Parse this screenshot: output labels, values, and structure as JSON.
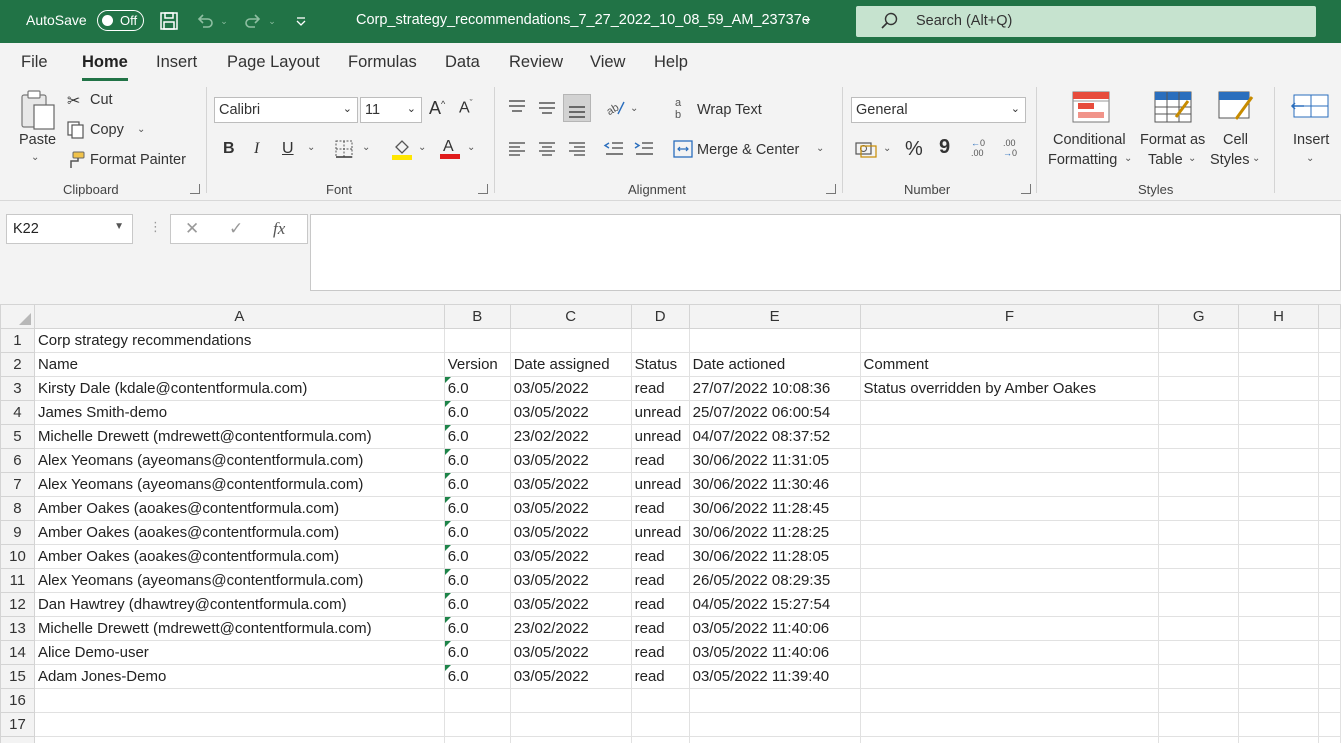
{
  "titlebar": {
    "autosave_label": "AutoSave",
    "autosave_state": "Off",
    "file_title": "Corp_strategy_recommendations_7_27_2022_10_08_59_AM_23737e",
    "search_placeholder": "Search (Alt+Q)",
    "icons": [
      "save-icon",
      "undo-icon",
      "redo-icon",
      "customize-qat-icon",
      "search-icon"
    ]
  },
  "tabs": [
    "File",
    "Home",
    "Insert",
    "Page Layout",
    "Formulas",
    "Data",
    "Review",
    "View",
    "Help"
  ],
  "ribbon": {
    "clipboard": {
      "paste": "Paste",
      "cut": "Cut",
      "copy": "Copy",
      "format_painter": "Format Painter",
      "group": "Clipboard"
    },
    "font": {
      "name": "Calibri",
      "size": "11",
      "bold": "B",
      "italic": "I",
      "underline": "U",
      "group": "Font"
    },
    "alignment": {
      "wrap_text": "Wrap Text",
      "merge_center": "Merge & Center",
      "group": "Alignment"
    },
    "number": {
      "format": "General",
      "percent": "%",
      "comma": "9",
      "group": "Number"
    },
    "styles": {
      "conditional_1": "Conditional",
      "conditional_2": "Formatting",
      "format_table_1": "Format as",
      "format_table_2": "Table",
      "cell_styles_1": "Cell",
      "cell_styles_2": "Styles",
      "group": "Styles"
    },
    "cells": {
      "insert": "Insert"
    }
  },
  "formula_bar": {
    "name_box": "K22",
    "cancel": "✕",
    "enter": "✓",
    "fx": "fx",
    "content": ""
  },
  "grid": {
    "columns": [
      "A",
      "B",
      "C",
      "D",
      "E",
      "F",
      "G",
      "H"
    ],
    "rows": [
      {
        "n": "1",
        "cells": [
          "Corp strategy recommendations",
          "",
          "",
          "",
          "",
          ""
        ]
      },
      {
        "n": "2",
        "cells": [
          "Name",
          "Version",
          "Date assigned",
          "Status",
          "Date actioned",
          "Comment"
        ]
      },
      {
        "n": "3",
        "cells": [
          "Kirsty Dale (kdale@contentformula.com)",
          "6.0",
          "03/05/2022",
          "read",
          "27/07/2022 10:08:36",
          "Status overridden by Amber Oakes"
        ]
      },
      {
        "n": "4",
        "cells": [
          "James Smith-demo",
          "6.0",
          "03/05/2022",
          "unread",
          "25/07/2022 06:00:54",
          ""
        ]
      },
      {
        "n": "5",
        "cells": [
          "Michelle Drewett (mdrewett@contentformula.com)",
          "6.0",
          "23/02/2022",
          "unread",
          "04/07/2022 08:37:52",
          ""
        ]
      },
      {
        "n": "6",
        "cells": [
          "Alex Yeomans (ayeomans@contentformula.com)",
          "6.0",
          "03/05/2022",
          "read",
          "30/06/2022 11:31:05",
          ""
        ]
      },
      {
        "n": "7",
        "cells": [
          "Alex Yeomans (ayeomans@contentformula.com)",
          "6.0",
          "03/05/2022",
          "unread",
          "30/06/2022 11:30:46",
          ""
        ]
      },
      {
        "n": "8",
        "cells": [
          "Amber Oakes (aoakes@contentformula.com)",
          "6.0",
          "03/05/2022",
          "read",
          "30/06/2022 11:28:45",
          ""
        ]
      },
      {
        "n": "9",
        "cells": [
          "Amber Oakes (aoakes@contentformula.com)",
          "6.0",
          "03/05/2022",
          "unread",
          "30/06/2022 11:28:25",
          ""
        ]
      },
      {
        "n": "10",
        "cells": [
          "Amber Oakes (aoakes@contentformula.com)",
          "6.0",
          "03/05/2022",
          "read",
          "30/06/2022 11:28:05",
          ""
        ]
      },
      {
        "n": "11",
        "cells": [
          "Alex Yeomans (ayeomans@contentformula.com)",
          "6.0",
          "03/05/2022",
          "read",
          "26/05/2022 08:29:35",
          ""
        ]
      },
      {
        "n": "12",
        "cells": [
          "Dan Hawtrey (dhawtrey@contentformula.com)",
          "6.0",
          "03/05/2022",
          "read",
          "04/05/2022 15:27:54",
          ""
        ]
      },
      {
        "n": "13",
        "cells": [
          "Michelle Drewett (mdrewett@contentformula.com)",
          "6.0",
          "23/02/2022",
          "read",
          "03/05/2022 11:40:06",
          ""
        ]
      },
      {
        "n": "14",
        "cells": [
          "Alice Demo-user",
          "6.0",
          "03/05/2022",
          "read",
          "03/05/2022 11:40:06",
          ""
        ]
      },
      {
        "n": "15",
        "cells": [
          "Adam Jones-Demo",
          "6.0",
          "03/05/2022",
          "read",
          "03/05/2022 11:39:40",
          ""
        ]
      },
      {
        "n": "16",
        "cells": [
          "",
          "",
          "",
          "",
          "",
          ""
        ]
      },
      {
        "n": "17",
        "cells": [
          "",
          "",
          "",
          "",
          "",
          ""
        ]
      },
      {
        "n": "18",
        "cells": [
          "",
          "",
          "",
          "",
          "",
          ""
        ]
      }
    ]
  },
  "colors": {
    "accent": "#217346",
    "search_bg": "#c6e3cf",
    "ribbon_bg": "#f3f3f3"
  }
}
